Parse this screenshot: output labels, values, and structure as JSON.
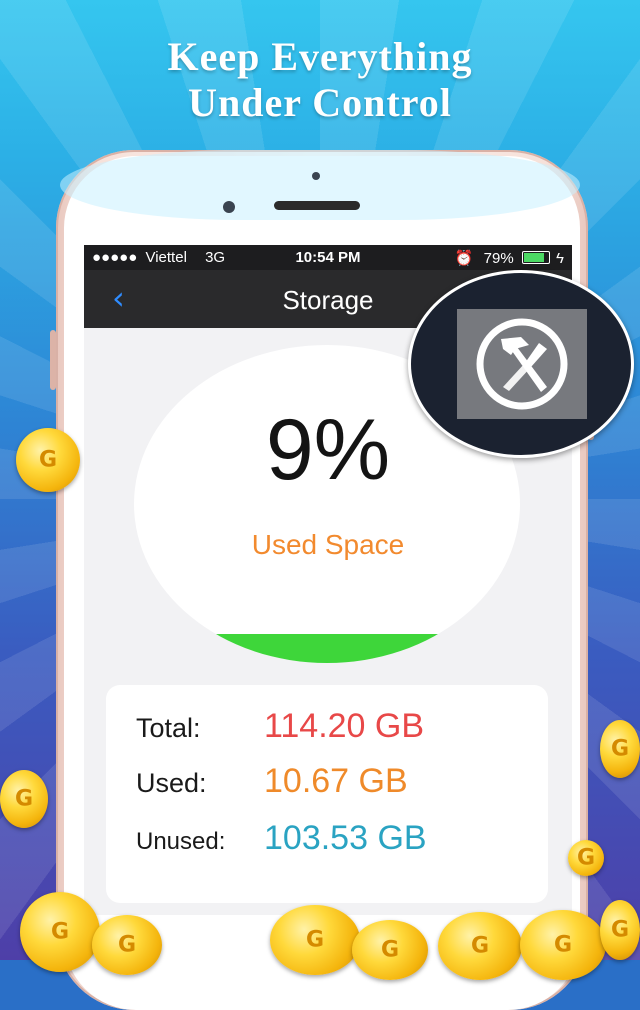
{
  "promo": {
    "headline_line1": "Keep Everything",
    "headline_line2": "Under Control"
  },
  "status_bar": {
    "signal": "●●●●●",
    "carrier": "Viettel",
    "network": "3G",
    "time": "10:54 PM",
    "battery_text": "79%",
    "battery_level": 0.79
  },
  "nav": {
    "back_glyph": "‹",
    "title": "Storage"
  },
  "gauge": {
    "percent": "9%",
    "label": "Used Space",
    "used_fraction": 0.09
  },
  "storage": {
    "rows": [
      {
        "label": "Total:",
        "value": "114.20 GB",
        "color": "#e84848"
      },
      {
        "label": "Used:",
        "value": "10.67 GB",
        "color": "#ef8a2a"
      },
      {
        "label": "Unused:",
        "value": "103.53 GB",
        "color": "#2aa3c2"
      }
    ]
  },
  "colors": {
    "accent_blue": "#2f8cff",
    "used_orange": "#f28a2e",
    "gauge_green": "#3ed63a"
  },
  "icons": {
    "badge": "tools-hammer-screwdriver-icon",
    "coin": "gold-coin-icon"
  }
}
